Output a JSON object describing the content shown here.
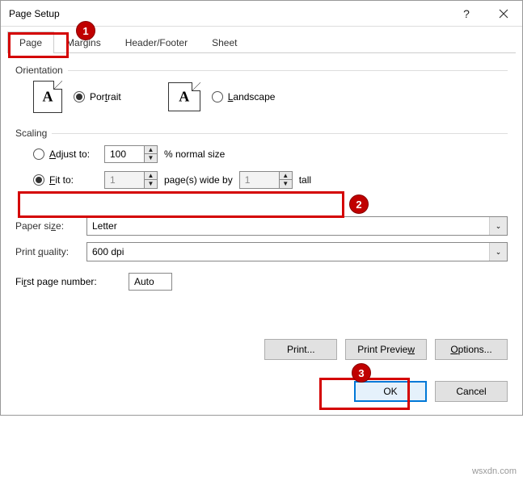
{
  "title": "Page Setup",
  "tabs": {
    "page": "Page",
    "margins": "Margins",
    "hf": "Header/Footer",
    "sheet": "Sheet"
  },
  "orientation": {
    "label": "Orientation",
    "portrait": "Portrait",
    "landscape": "Landscape"
  },
  "scaling": {
    "label": "Scaling",
    "adjust": "Adjust to:",
    "adjust_val": "100",
    "pct": "% normal size",
    "fit": "Fit to:",
    "fit_w": "1",
    "wideby": "page(s) wide by",
    "fit_h": "1",
    "tall": "tall"
  },
  "paper": {
    "label": "Paper size:",
    "value": "Letter"
  },
  "quality": {
    "label": "Print quality:",
    "value": "600 dpi"
  },
  "firstpage": {
    "label": "First page number:",
    "value": "Auto"
  },
  "buttons": {
    "print": "Print...",
    "preview": "Print Preview",
    "options": "Options...",
    "ok": "OK",
    "cancel": "Cancel"
  },
  "callouts": {
    "c1": "1",
    "c2": "2",
    "c3": "3"
  },
  "watermark": "wsxdn.com"
}
